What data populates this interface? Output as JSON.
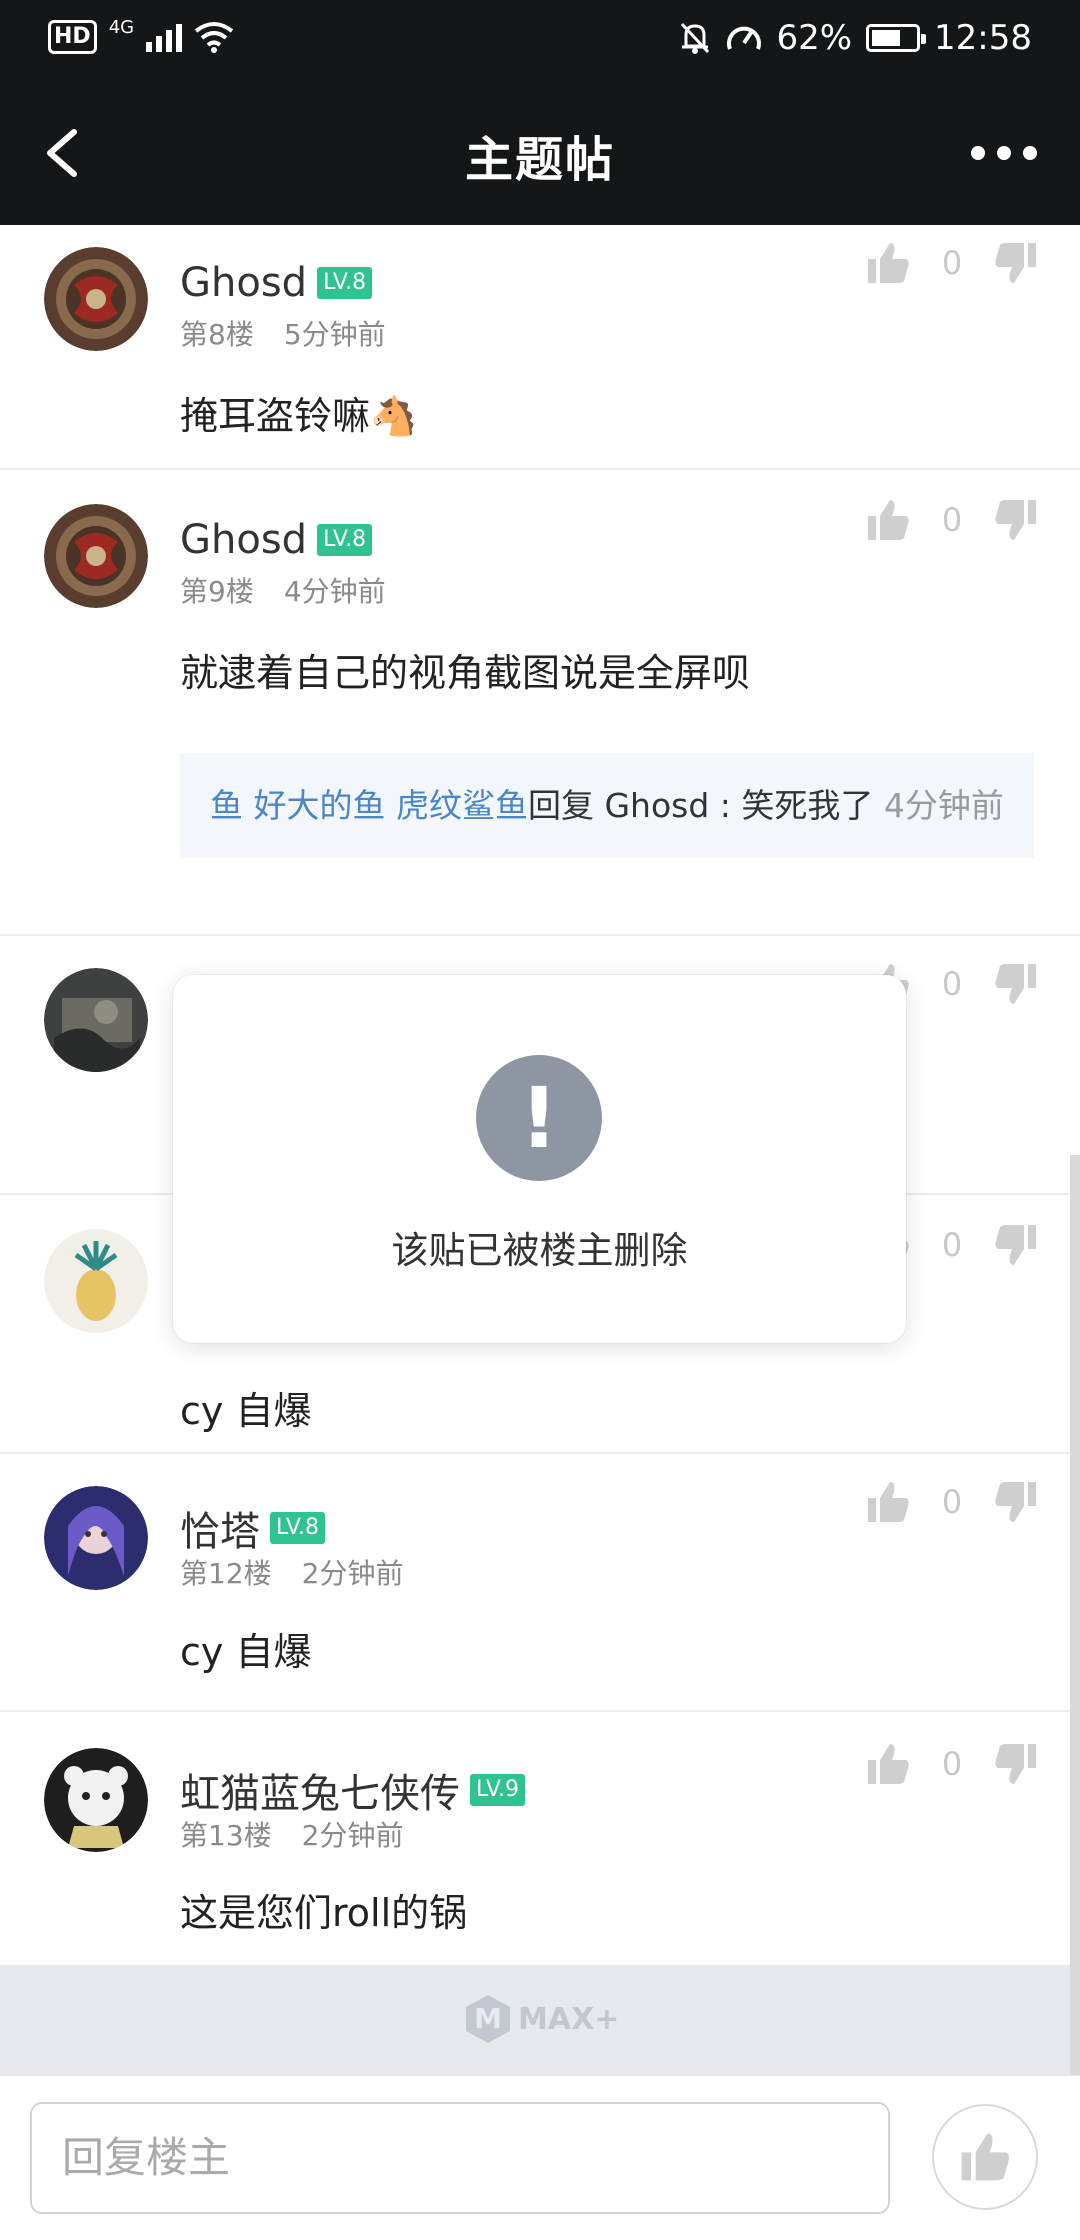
{
  "status_bar": {
    "hd": "HD",
    "network": "4G",
    "battery": "62%",
    "time": "12:58"
  },
  "header": {
    "title": "主题帖"
  },
  "posts": [
    {
      "username": "Ghosd",
      "level": "LV.8",
      "floor": "第8楼",
      "time": "5分钟前",
      "text": "掩耳盗铃嘛",
      "emoji": "🐴",
      "likes": "0",
      "avatar": "shield-avatar"
    },
    {
      "username": "Ghosd",
      "level": "LV.8",
      "floor": "第9楼",
      "time": "4分钟前",
      "text": "就逮着自己的视角截图说是全屏呗",
      "likes": "0",
      "avatar": "shield-avatar",
      "reply": {
        "link_text": "鱼 好大的鱼 虎纹鲨鱼",
        "reply_text": "回复 Ghosd : 笑死我了 ",
        "time": "4分钟前"
      }
    },
    {
      "likes": "0",
      "avatar": "dark-avatar"
    },
    {
      "text": "cy 自爆",
      "likes": "0",
      "avatar": "pineapple-avatar"
    },
    {
      "username": "恰塔",
      "level": "LV.8",
      "floor": "第12楼",
      "time": "2分钟前",
      "text": "cy 自爆",
      "likes": "0",
      "avatar": "anime-avatar"
    },
    {
      "username": "虹猫蓝兔七侠传",
      "level": "LV.9",
      "floor": "第13楼",
      "time": "2分钟前",
      "text": "这是您们roll的锅",
      "likes": "0",
      "avatar": "cat-avatar"
    }
  ],
  "modal": {
    "icon": "!",
    "message": "该贴已被楼主删除"
  },
  "footer": {
    "logo_mark": "M",
    "logo_text": "MAX+"
  },
  "bottom_bar": {
    "placeholder": "回复楼主"
  },
  "colors": {
    "header_bg": "#141617",
    "level_badge": "#2fc38f",
    "reply_link": "#4b86c6",
    "reply_bg": "#f3f7fb",
    "modal_icon": "#8f96a3"
  }
}
